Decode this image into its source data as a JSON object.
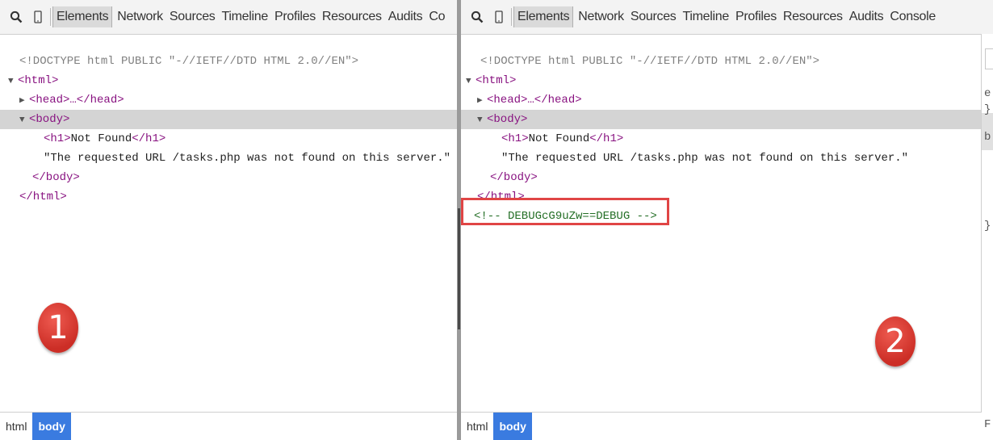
{
  "toolbar": {
    "tabs": [
      "Elements",
      "Network",
      "Sources",
      "Timeline",
      "Profiles",
      "Resources",
      "Audits",
      "Console"
    ],
    "active_tab": "Elements"
  },
  "panel1": {
    "tabs_visible": [
      "Elements",
      "Network",
      "Sources",
      "Timeline",
      "Profiles",
      "Resources",
      "Audits",
      "Co"
    ]
  },
  "dom": {
    "doctype": "<!DOCTYPE html PUBLIC \"-//IETF//DTD HTML 2.0//EN\">",
    "html_open": "<html>",
    "head": "<head>…</head>",
    "body_open": "<body>",
    "h1": "<h1>Not Found</h1>",
    "h1_open": "<h1>",
    "h1_text": "Not Found",
    "h1_close": "</h1>",
    "text": "\"The requested URL /tasks.php was not found on this server.\"",
    "body_close": "</body>",
    "html_close": "</html>",
    "comment": "<!-- DEBUGcG9uZw==DEBUG -->"
  },
  "badges": [
    "1",
    "2"
  ],
  "breadcrumbs": [
    "html",
    "body"
  ],
  "styles_strip": [
    "e",
    "}",
    "b",
    "}",
    "F"
  ],
  "colors": {
    "tag": "#881280",
    "comment": "#236e25",
    "highlight": "#e04545",
    "badge": "#d9342b",
    "crumb_active": "#3a7be0"
  }
}
